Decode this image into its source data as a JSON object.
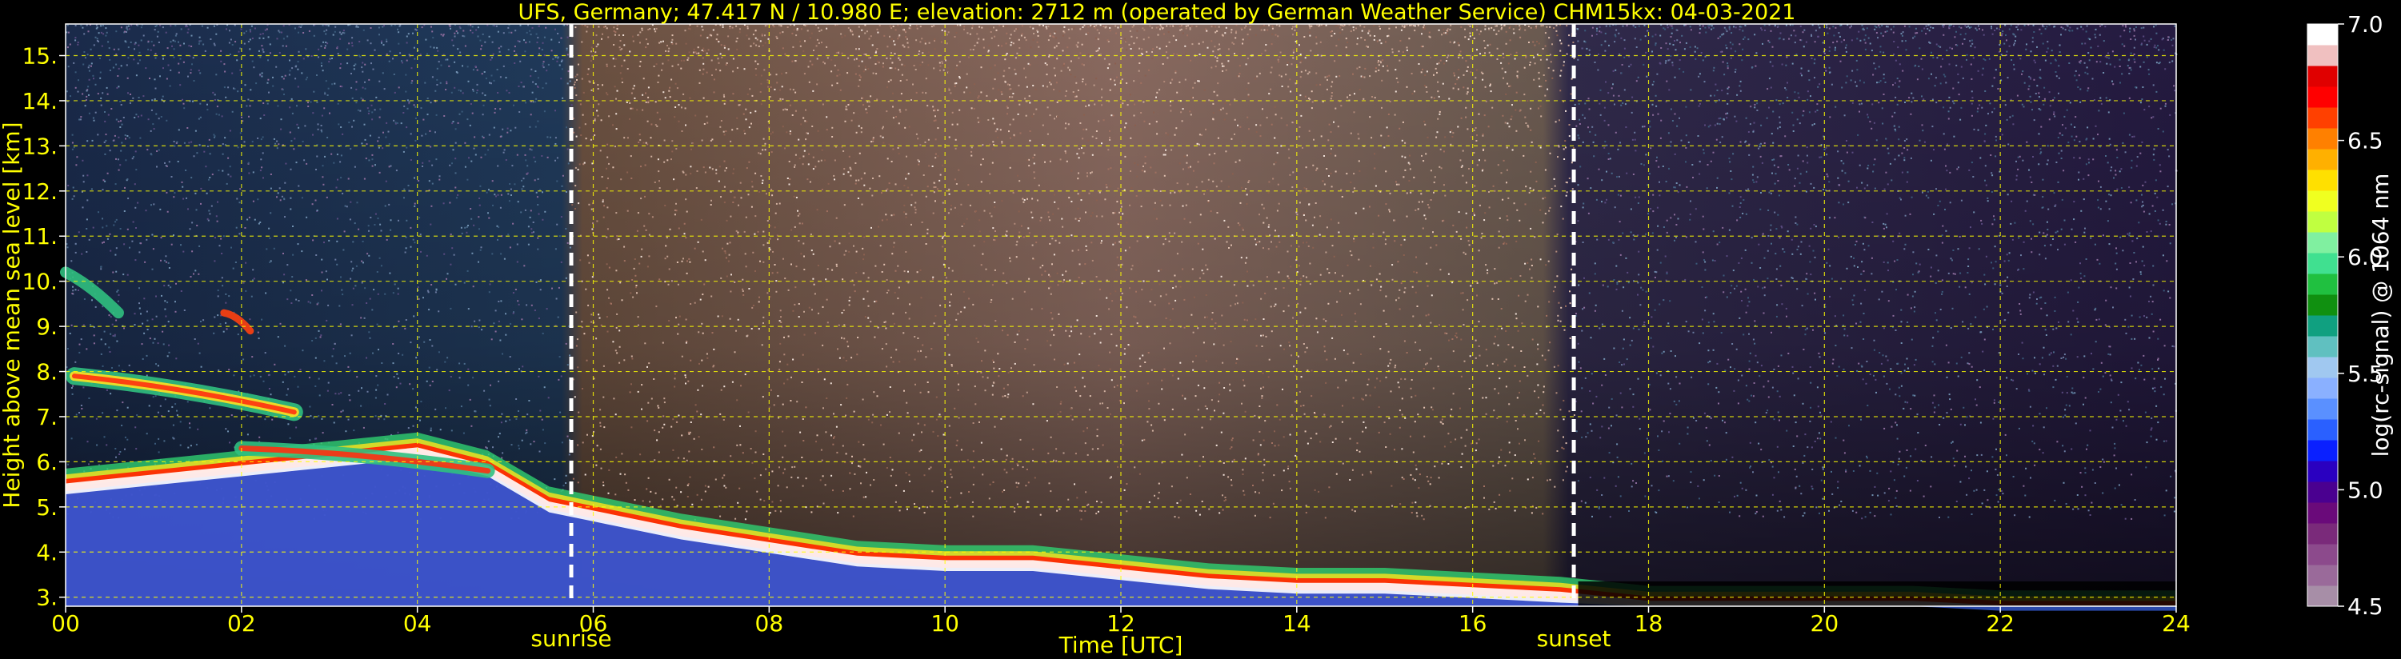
{
  "chart_data": {
    "type": "heatmap",
    "title": "UFS, Germany; 47.417 N / 10.980 E; elevation: 2712 m  (operated by German Weather Service)    CHM15kx: 04-03-2021",
    "xlabel": "Time [UTC]",
    "ylabel": "Height above mean sea level [km]",
    "xlim": [
      0,
      24
    ],
    "ylim": [
      2.8,
      15.7
    ],
    "xticks": [
      0,
      2,
      4,
      6,
      8,
      10,
      12,
      14,
      16,
      18,
      20,
      22,
      24
    ],
    "xtick_labels": [
      "00",
      "02",
      "04",
      "06",
      "08",
      "10",
      "12",
      "14",
      "16",
      "18",
      "20",
      "22",
      "24"
    ],
    "yticks": [
      3,
      4,
      5,
      6,
      7,
      8,
      9,
      10,
      11,
      12,
      13,
      14,
      15
    ],
    "ytick_labels": [
      "3.",
      "4.",
      "5.",
      "6.",
      "7.",
      "8.",
      "9.",
      "10.",
      "11.",
      "12.",
      "13.",
      "14.",
      "15."
    ],
    "grid": true,
    "events": [
      {
        "label": "sunrise",
        "time": 5.75
      },
      {
        "label": "sunset",
        "time": 17.15
      }
    ],
    "colorbar": {
      "label": "log(rc-signal) @ 1064 nm",
      "range": [
        4.5,
        7.0
      ],
      "ticks": [
        4.5,
        5.0,
        5.5,
        6.0,
        6.5,
        7.0
      ],
      "tick_labels": [
        "4.5",
        "5.0",
        "5.5",
        "6.0",
        "6.5",
        "7.0"
      ],
      "colors": [
        "#a78ea7",
        "#9a6a9a",
        "#8c4a8c",
        "#7a2a7a",
        "#6a0a7a",
        "#4a0090",
        "#2a00c0",
        "#0a20ff",
        "#2a60ff",
        "#5a90ff",
        "#8ab0ff",
        "#a0c8f0",
        "#60c0c0",
        "#10a080",
        "#109010",
        "#20c040",
        "#40e090",
        "#80f0a0",
        "#c0ff40",
        "#f0ff20",
        "#ffe000",
        "#ffb000",
        "#ff8000",
        "#ff4000",
        "#ff0000",
        "#e00000",
        "#f0c0c0",
        "#ffffff"
      ]
    },
    "aerosol_layer_top_km": [
      [
        0.0,
        5.6
      ],
      [
        1.0,
        5.8
      ],
      [
        2.0,
        6.0
      ],
      [
        3.0,
        6.2
      ],
      [
        4.0,
        6.4
      ],
      [
        4.8,
        6.0
      ],
      [
        5.5,
        5.2
      ],
      [
        6.0,
        5.0
      ],
      [
        7.0,
        4.6
      ],
      [
        8.0,
        4.3
      ],
      [
        9.0,
        4.0
      ],
      [
        10.0,
        3.9
      ],
      [
        11.0,
        3.9
      ],
      [
        12.0,
        3.7
      ],
      [
        13.0,
        3.5
      ],
      [
        14.0,
        3.4
      ],
      [
        15.0,
        3.4
      ],
      [
        16.0,
        3.3
      ],
      [
        17.0,
        3.2
      ],
      [
        18.0,
        3.0
      ],
      [
        19.0,
        3.0
      ],
      [
        20.0,
        3.0
      ],
      [
        21.0,
        3.0
      ],
      [
        22.0,
        2.9
      ],
      [
        24.0,
        2.9
      ]
    ]
  }
}
